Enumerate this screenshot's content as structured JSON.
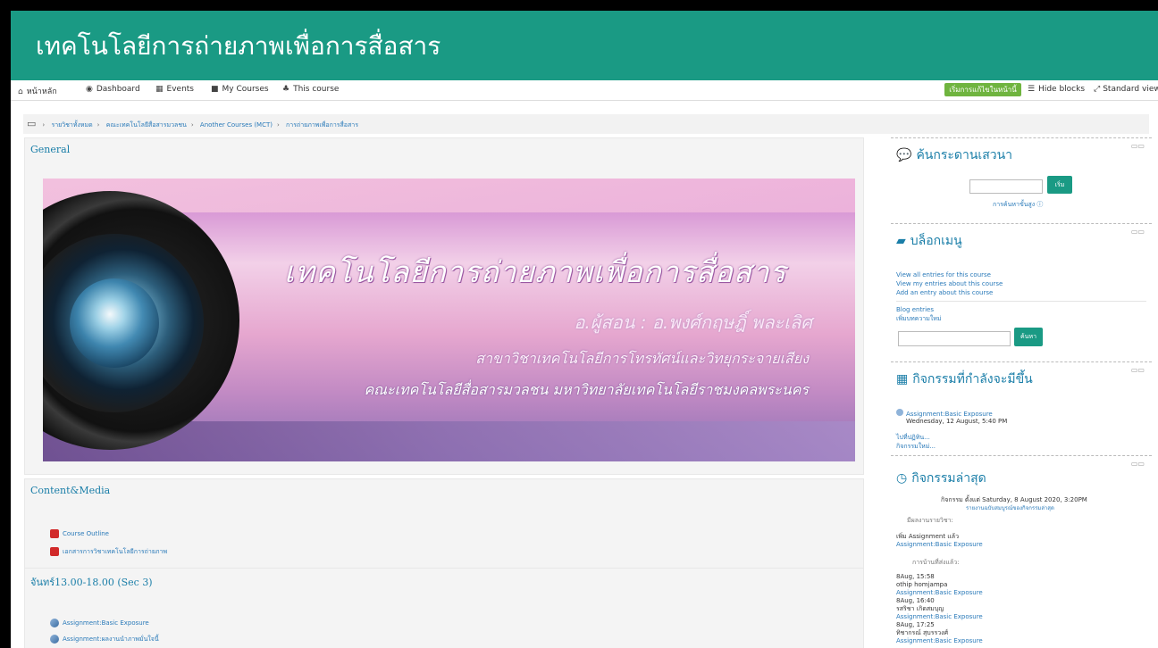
{
  "site_title": "เทคโนโลยีการถ่ายภาพเพื่อการสื่อสาร",
  "nav": {
    "home": "หน้าหลัก",
    "dashboard": "Dashboard",
    "events": "Events",
    "my_courses": "My Courses",
    "this_course": "This course",
    "edit_button": "เริ่มการแก้ไขในหน้านี้",
    "hide_blocks": "Hide blocks",
    "standard_view": "Standard view"
  },
  "breadcrumb": [
    "รายวิชาทั้งหมด",
    "คณะเทคโนโลยีสื่อสารมวลชน",
    "Another Courses (MCT)",
    "การถ่ายภาพเพื่อการสื่อสาร"
  ],
  "sections": {
    "general": {
      "title": "General",
      "hero_title": "เทคโนโลยีการถ่ายภาพเพื่อการสื่อสาร",
      "hero_instructor": "อ.ผู้สอน : อ.พงศ์กฤษฎิ์ พละเลิศ",
      "hero_dept": "สาขาวิชาเทคโนโลยีการโทรทัศน์และวิทยุกระจายเสียง",
      "hero_faculty": "คณะเทคโนโลยีสื่อสารมวลชน มหาวิทยาลัยเทคโนโลยีราชมงคลพระนคร"
    },
    "content": {
      "title": "Content&Media",
      "items": [
        "Course Outline",
        "เอกสารการวิชาเทคโนโลยีการถ่ายภาพ"
      ]
    },
    "sec3": {
      "title": "จันทร์13.00-18.00 (Sec 3)",
      "items": [
        "Assignment:Basic Exposure",
        "Assignment:ผลงานนำภาพมั่นใจนี้"
      ]
    }
  },
  "blocks": {
    "forum": {
      "title": "ค้นกระดานเสวนา",
      "go_button": "เริ่ม",
      "advanced": "การค้นหาขั้นสูง ⓘ"
    },
    "blog": {
      "title": "บล็อกเมนู",
      "links": [
        "View all entries for this course",
        "View my entries about this course",
        "Add an entry about this course"
      ],
      "links2": [
        "Blog entries",
        "เพิ่มบทความใหม่"
      ],
      "search_button": "ค้นหา"
    },
    "upcoming": {
      "title": "กิจกรรมที่กำลังจะมีขึ้น",
      "event_name": "Assignment:Basic Exposure",
      "event_date": "Wednesday, 12 August, 5:40 PM",
      "links": [
        "ไปที่ปฏิทิน...",
        "กิจกรรมใหม่..."
      ]
    },
    "recent": {
      "title": "กิจกรรมล่าสุด",
      "since": "กิจกรรม ตั้งแต่ Saturday, 8 August 2020, 3:20PM",
      "full_report": "รายงานฉบับสมบูรณ์ของกิจกรรมล่าสุด",
      "updated_label": "มีผลงานรายวิชา:",
      "added": "เพิ่ม Assignment แล้ว",
      "added_link": "Assignment:Basic Exposure",
      "submissions_label": "การบ้านที่ส่งแล้ว:",
      "entries": [
        {
          "time": "8Aug, 15:58",
          "name": "othip homjampa",
          "item": "Assignment:Basic Exposure"
        },
        {
          "time": "8Aug, 16:40",
          "name": "รสริชา เกิดสมบุญ",
          "item": "Assignment:Basic Exposure"
        },
        {
          "time": "8Aug, 17:25",
          "name": "ทิชากรณ์ สุบรรวงศ์",
          "item": "Assignment:Basic Exposure"
        }
      ]
    }
  },
  "colors": {
    "brand": "#1a9a84",
    "link": "#2a7ab9",
    "edit_button": "#6fb43f"
  }
}
